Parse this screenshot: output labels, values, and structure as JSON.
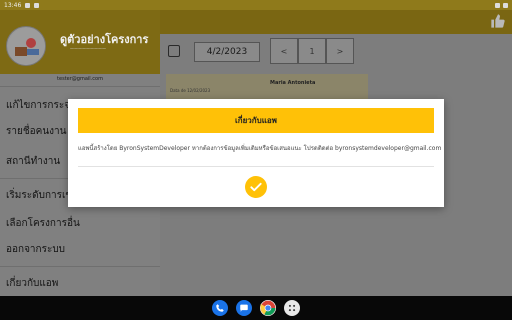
{
  "status_bar": {
    "time": "13:46"
  },
  "drawer": {
    "title": "ดูตัวอย่างโครงการ",
    "subtitle": "—————————",
    "email": "tester@gmail.com",
    "items": [
      {
        "label": "แก้ไขการกระจ"
      },
      {
        "label": "รายชื่อคนงาน"
      },
      {
        "label": "สถานีทำงาน"
      },
      {
        "label": "เริ่มระดับการเข"
      },
      {
        "label": "เลือกโครงการอื่น"
      },
      {
        "label": "ออกจากระบบ"
      },
      {
        "label": "เกี่ยวกับแอพ"
      }
    ]
  },
  "main": {
    "date": "4/2/2023",
    "segments": [
      "<",
      "1",
      ">"
    ],
    "card_name": "Maria Antonieta",
    "card_sub": "Data de 12/02/2023"
  },
  "dialog": {
    "title": "เกี่ยวกับแอพ",
    "body": "แอพนี้สร้างโดย ByronSystemDeveloper หากต้องการข้อมูลเพิ่มเติมหรือข้อเสนอแนะ โปรดติดต่อ byronsystemdeveloper@gmail.com",
    "ok_icon": "check-circle-icon",
    "accent": "#ffc107"
  },
  "navbar": {
    "icons": [
      "phone-icon",
      "messages-icon",
      "chrome-icon",
      "app-drawer-icon"
    ]
  }
}
